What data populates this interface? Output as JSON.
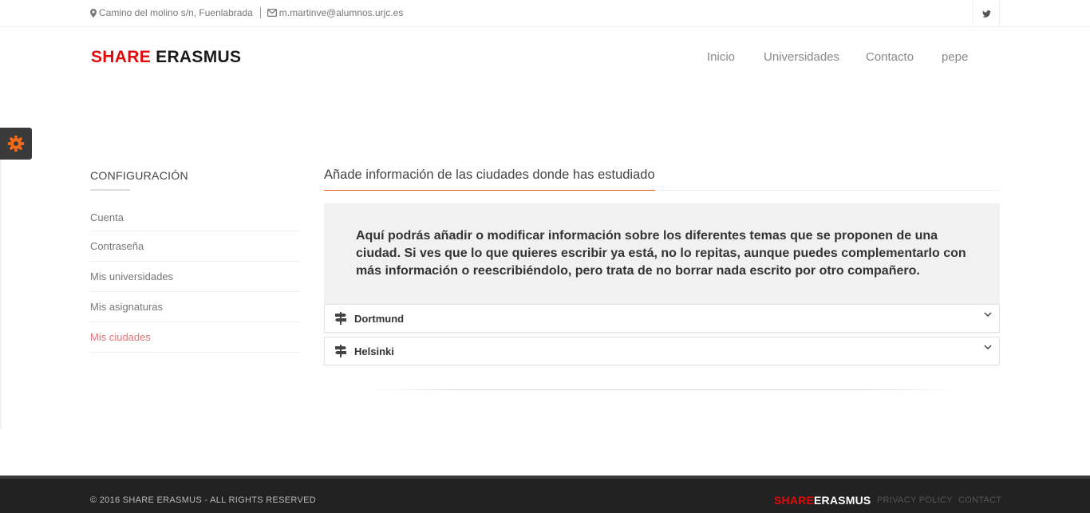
{
  "topbar": {
    "address": "Camino del molino s/n, Fuenlabrada",
    "email": "m.martinve@alumnos.urjc.es",
    "social_icon": "twitter-icon"
  },
  "header": {
    "logo_part1": "SHARE",
    "logo_part2": "ERASMUS",
    "nav": [
      "Inicio",
      "Universidades",
      "Contacto",
      "pepe"
    ]
  },
  "settings_tab": {
    "icon": "gear-icon",
    "color": "#f06a1a"
  },
  "sidebar": {
    "title": "CONFIGURACIÓN",
    "items": [
      {
        "label": "Cuenta",
        "active": false
      },
      {
        "label": "Contraseña",
        "active": false
      },
      {
        "label": "Mis universidades",
        "active": false
      },
      {
        "label": "Mis asignaturas",
        "active": false
      },
      {
        "label": "Mis ciudades",
        "active": true
      }
    ]
  },
  "main": {
    "heading": "Añade información de las ciudades donde has estudiado",
    "info": "Aquí podrás añadir o modificar información sobre los diferentes temas que se proponen de una ciudad. Si ves que lo que quieres escribir ya está, no lo repitas, aunque puedes complementarlo con más información o reescribiéndolo, pero trata de no borrar nada escrito por otro compañero.",
    "cities": [
      {
        "name": "Dortmund",
        "icon": "signpost-icon"
      },
      {
        "name": "Helsinki",
        "icon": "signpost-icon"
      }
    ]
  },
  "footer": {
    "copyright": "© 2016 SHARE ERASMUS - ALL RIGHTS RESERVED",
    "logo_part1": "SHARE",
    "logo_part2": "ERASMUS",
    "privacy": "PRIVACY POLICY",
    "contact": "CONTACT"
  },
  "colors": {
    "brand_red": "#e10b0b",
    "accent_orange": "#e05a1a",
    "active_link": "#e57272"
  }
}
